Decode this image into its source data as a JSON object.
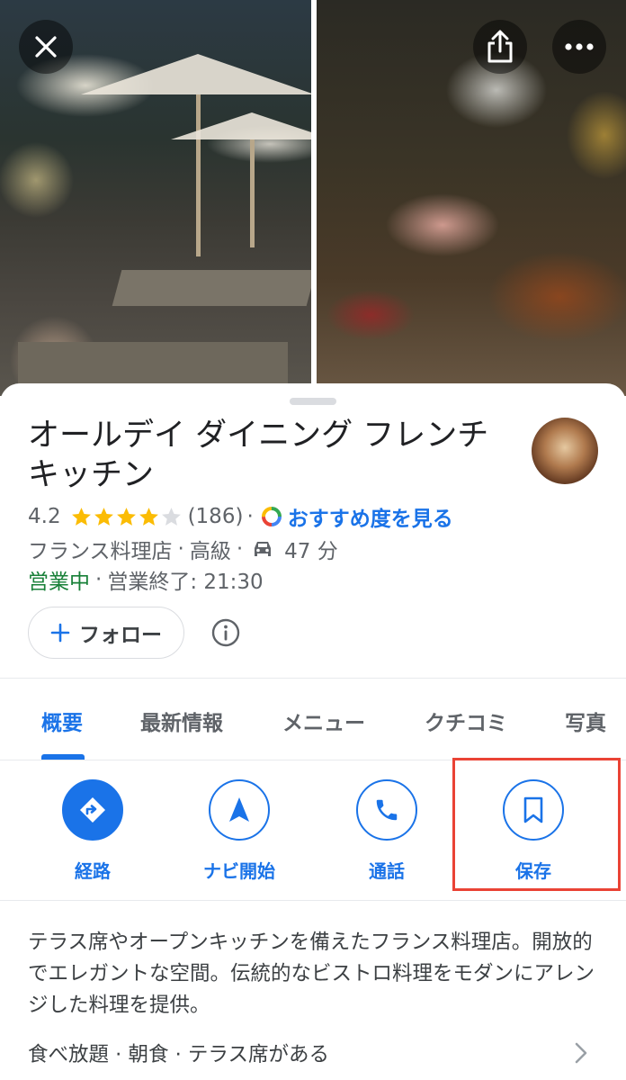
{
  "place": {
    "name": "オールデイ ダイニング フレンチ キッチン",
    "rating": "4.2",
    "rating_value": 4.2,
    "review_count": "(186)",
    "separator": "·",
    "recommend_link": "おすすめ度を見る",
    "category": "フランス料理店",
    "price_level": "高級",
    "drive_time": "47 分",
    "open_status": "営業中",
    "closing": "営業終了: 21:30"
  },
  "follow_button": {
    "label": "フォロー"
  },
  "tabs": [
    {
      "label": "概要",
      "active": true
    },
    {
      "label": "最新情報",
      "active": false
    },
    {
      "label": "メニュー",
      "active": false
    },
    {
      "label": "クチコミ",
      "active": false
    },
    {
      "label": "写真",
      "active": false
    }
  ],
  "actions": [
    {
      "label": "経路",
      "icon": "directions-icon"
    },
    {
      "label": "ナビ開始",
      "icon": "navigation-arrow-icon"
    },
    {
      "label": "通話",
      "icon": "phone-icon"
    },
    {
      "label": "保存",
      "icon": "bookmark-icon"
    }
  ],
  "description": "テラス席やオープンキッチンを備えたフランス料理店。開放的でエレガントな空間。伝統的なビストロ料理をモダンにアレンジした料理を提供。",
  "features": "食べ放題 · 朝食 · テラス席がある",
  "colors": {
    "accent": "#1a73e8",
    "open_green": "#188038",
    "star": "#fbbc04",
    "highlight": "#ea4335"
  }
}
